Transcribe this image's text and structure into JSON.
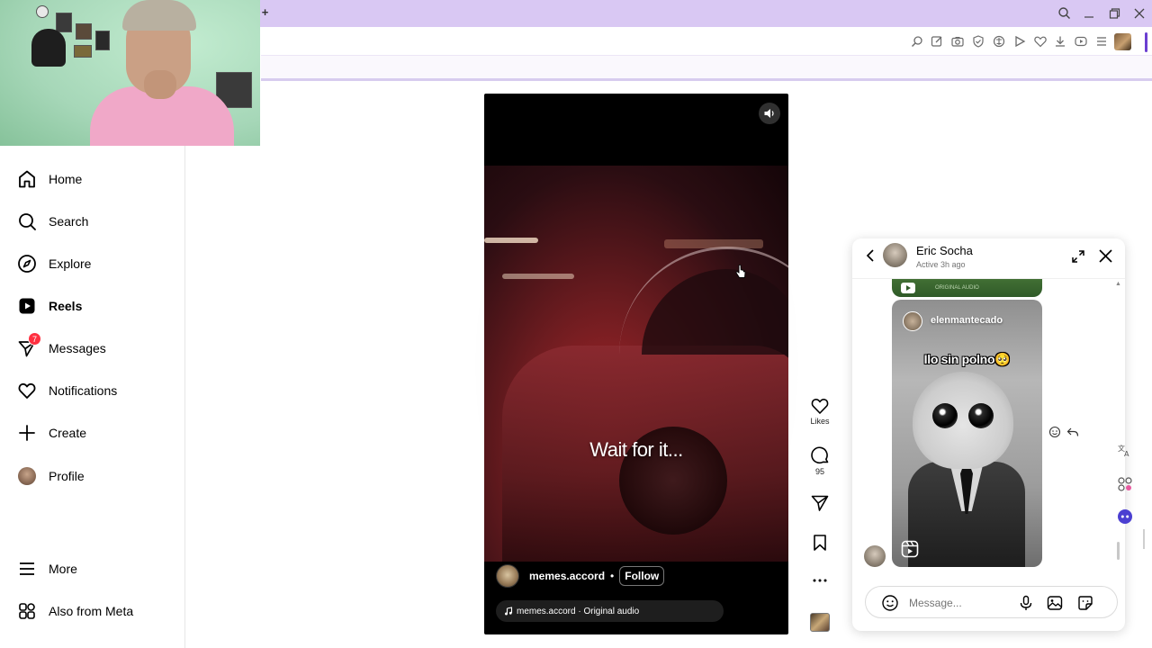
{
  "browser": {
    "new_tab_symbol": "+",
    "window_controls": [
      "search-icon",
      "minimize-icon",
      "restore-icon",
      "close-icon"
    ],
    "toolbar_icons": [
      "zoom-icon",
      "edit-icon",
      "camera-icon",
      "shield-icon",
      "translate-icon",
      "play-icon",
      "heart-icon",
      "download-icon",
      "media-icon",
      "menu-icon"
    ]
  },
  "sidebar": {
    "items": [
      {
        "label": "Home",
        "icon": "home-icon"
      },
      {
        "label": "Search",
        "icon": "search-icon"
      },
      {
        "label": "Explore",
        "icon": "compass-icon"
      },
      {
        "label": "Reels",
        "icon": "reels-icon",
        "active": true
      },
      {
        "label": "Messages",
        "icon": "messenger-icon",
        "badge": "7"
      },
      {
        "label": "Notifications",
        "icon": "heart-icon"
      },
      {
        "label": "Create",
        "icon": "plus-icon"
      },
      {
        "label": "Profile",
        "icon": "avatar"
      },
      {
        "label": "More",
        "icon": "hamburger-icon"
      },
      {
        "label": "Also from Meta",
        "icon": "meta-apps-icon"
      }
    ]
  },
  "reel": {
    "caption": "Wait for it...",
    "author": "memes.accord",
    "separator": "•",
    "follow_label": "Follow",
    "audio": "memes.accord · Original audio"
  },
  "actions": {
    "likes_label": "Likes",
    "comments_count": "95"
  },
  "chat": {
    "name": "Eric Socha",
    "status": "Active 3h ago",
    "prev_media_text": "ORIGINAL AUDIO",
    "shared_reel": {
      "username": "elenmantecado",
      "caption": "Ilo sin polno🥺"
    },
    "input_placeholder": "Message..."
  },
  "colors": {
    "chrome": "#d9c8f3",
    "accent": "#6b3fd1",
    "badge": "#ff3040",
    "reel_red": "#b0272b"
  }
}
